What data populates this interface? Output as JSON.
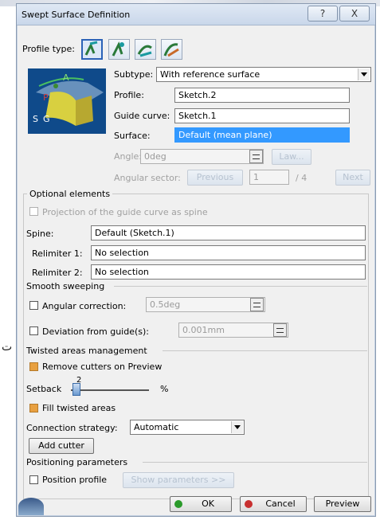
{
  "background": {
    "mark": "ت"
  },
  "window": {
    "title": "Swept Surface Definition",
    "help_btn": "?",
    "close_btn": "X"
  },
  "profile_type": {
    "label": "Profile type:",
    "icons": [
      "line-profile-icon",
      "circle-profile-icon",
      "conic-profile-icon",
      "explicit-profile-icon"
    ]
  },
  "subtype": {
    "label": "Subtype:",
    "value": "With reference surface"
  },
  "profile": {
    "label": "Profile:",
    "value": "Sketch.2"
  },
  "guide_curve": {
    "label": "Guide curve:",
    "value": "Sketch.1"
  },
  "surface": {
    "label": "Surface:",
    "value": "Default (mean plane)"
  },
  "angle": {
    "label": "Angle:",
    "value": "0deg",
    "law_btn": "Law..."
  },
  "angular_sector": {
    "label": "Angular sector:",
    "prev_btn": "Previous",
    "value": "1",
    "total": "/ 4",
    "next_btn": "Next"
  },
  "preview_labels": {
    "a": "A",
    "p": "P",
    "s": "S",
    "g": "G"
  },
  "optional": {
    "title": "Optional elements",
    "projection_label": "Projection of the guide curve as spine",
    "spine_label": "Spine:",
    "spine_value": "Default (Sketch.1)",
    "relimiter1_label": "Relimiter 1:",
    "relimiter1_value": "No selection",
    "relimiter2_label": "Relimiter 2:",
    "relimiter2_value": "No selection"
  },
  "smooth": {
    "title": "Smooth sweeping",
    "angular_label": "Angular correction:",
    "angular_value": "0.5deg",
    "deviation_label": "Deviation from guide(s):",
    "deviation_value": "0.001mm"
  },
  "twisted": {
    "title": "Twisted areas management",
    "remove_label": "Remove cutters on Preview",
    "setback_label": "Setback",
    "setback_value": "2",
    "setback_unit": "%",
    "fill_label": "Fill twisted areas",
    "connection_label": "Connection strategy:",
    "connection_value": "Automatic",
    "add_cutter": "Add cutter"
  },
  "positioning": {
    "title": "Positioning parameters",
    "position_label": "Position profile",
    "show_params": "Show parameters >>"
  },
  "footer": {
    "ok": "OK",
    "cancel": "Cancel",
    "preview": "Preview"
  },
  "colors": {
    "selection": "#3399ff",
    "checked": "#e8a040",
    "ok_green": "#2a9a2a",
    "cancel_red": "#c83030"
  }
}
